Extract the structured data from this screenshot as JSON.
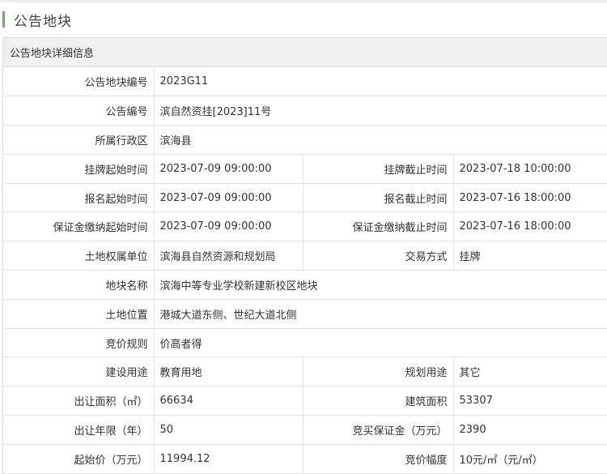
{
  "page": {
    "title": "公告地块"
  },
  "panel": {
    "header": "公告地块详细信息"
  },
  "rows": {
    "r1": {
      "label": "公告地块编号",
      "value": "2023G11"
    },
    "r2": {
      "label": "公告编号",
      "value": "滨自然资挂[2023]11号"
    },
    "r3": {
      "label": "所属行政区",
      "value": "滨海县"
    },
    "r4": {
      "label": "挂牌起始时间",
      "value": "2023-07-09 09:00:00",
      "label2": "挂牌截止时间",
      "value2": "2023-07-18 10:00:00"
    },
    "r5": {
      "label": "报名起始时间",
      "value": "2023-07-09 09:00:00",
      "label2": "报名截止时间",
      "value2": "2023-07-16 18:00:00"
    },
    "r6": {
      "label": "保证金缴纳起始时间",
      "value": "2023-07-09 09:00:00",
      "label2": "保证金缴纳截止时间",
      "value2": "2023-07-16 18:00:00"
    },
    "r7": {
      "label": "土地权属单位",
      "value": "滨海县自然资源和规划局",
      "label2": "交易方式",
      "value2": "挂牌"
    },
    "r8": {
      "label": "地块名称",
      "value": "滨海中等专业学校新建新校区地块"
    },
    "r9": {
      "label": "土地位置",
      "value": "港城大道东侧、世纪大道北侧"
    },
    "r10": {
      "label": "竞价规则",
      "value": "价高者得"
    },
    "r11": {
      "label": "建设用途",
      "value": "教育用地",
      "label2": "规划用途",
      "value2": "其它"
    },
    "r12": {
      "label": "出让面积（㎡）",
      "value": "66634",
      "label2": "建筑面积",
      "value2": "53307"
    },
    "r13": {
      "label": "出让年限（年）",
      "value": "50",
      "label2": "竞买保证金（万元）",
      "value2": "2390"
    },
    "r14": {
      "label": "起始价（万元）",
      "value": "11994.12",
      "label2": "竞价幅度",
      "value2": "10元/㎡（元/㎡）"
    }
  },
  "colors": {
    "accent": "#5cb85c",
    "header_bg": "#f0f0f0",
    "border": "#e4e4e4"
  }
}
